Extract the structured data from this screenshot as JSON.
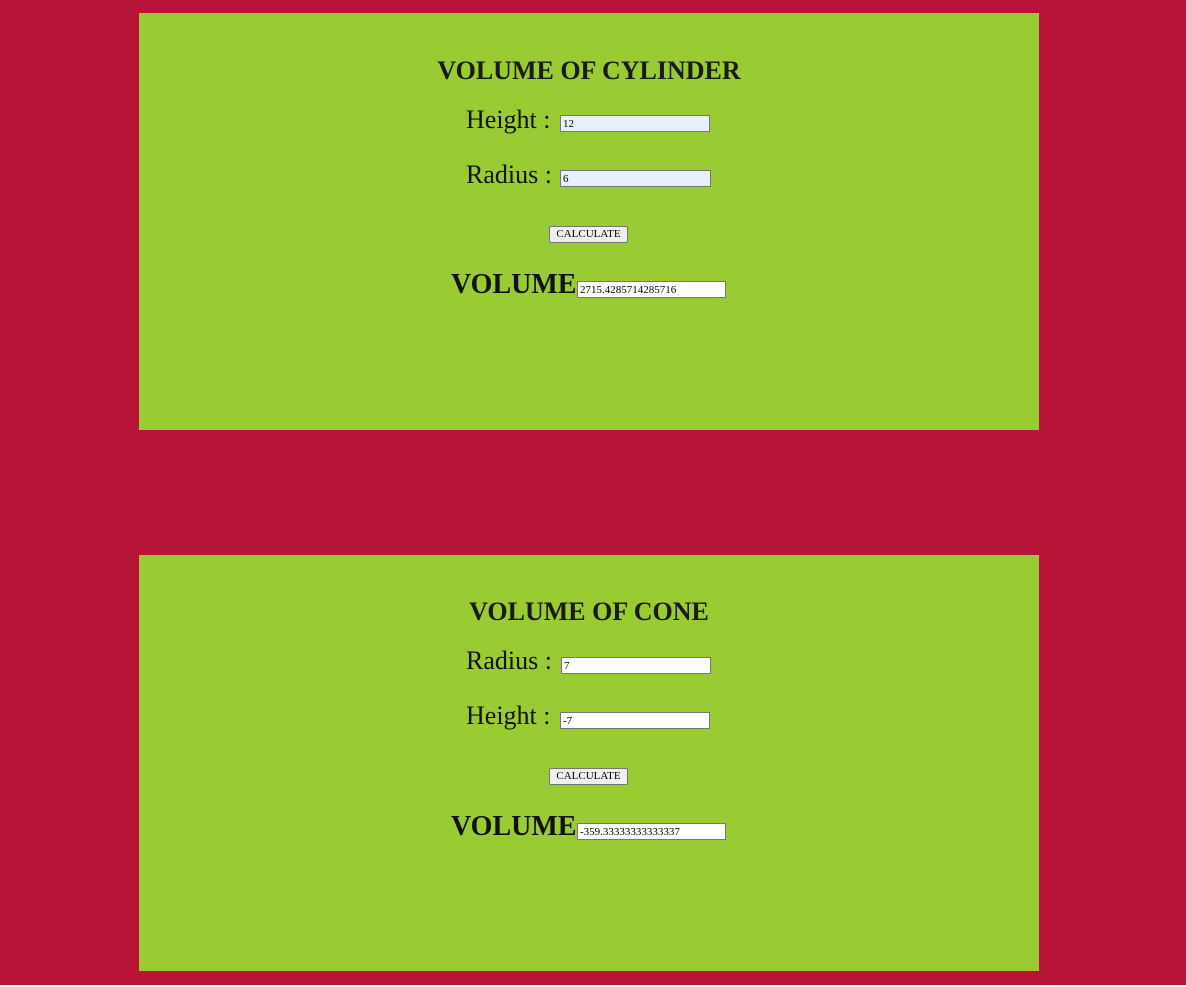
{
  "colors": {
    "page_background": "#b81438",
    "panel_background": "#99cb33",
    "autofill_field": "#e8f0fe"
  },
  "cylinder": {
    "title": "VOLUME OF CYLINDER",
    "height_label": "Height :",
    "height_value": "12",
    "radius_label": "Radius :",
    "radius_value": "6",
    "calculate_label": "CALCULATE",
    "volume_label": "VOLUME",
    "volume_value": "2715.4285714285716"
  },
  "cone": {
    "title": "VOLUME OF CONE",
    "radius_label": "Radius :",
    "radius_value": "7",
    "height_label": "Height :",
    "height_value": "-7",
    "calculate_label": "CALCULATE",
    "volume_label": "VOLUME",
    "volume_value": "-359.33333333333337"
  }
}
